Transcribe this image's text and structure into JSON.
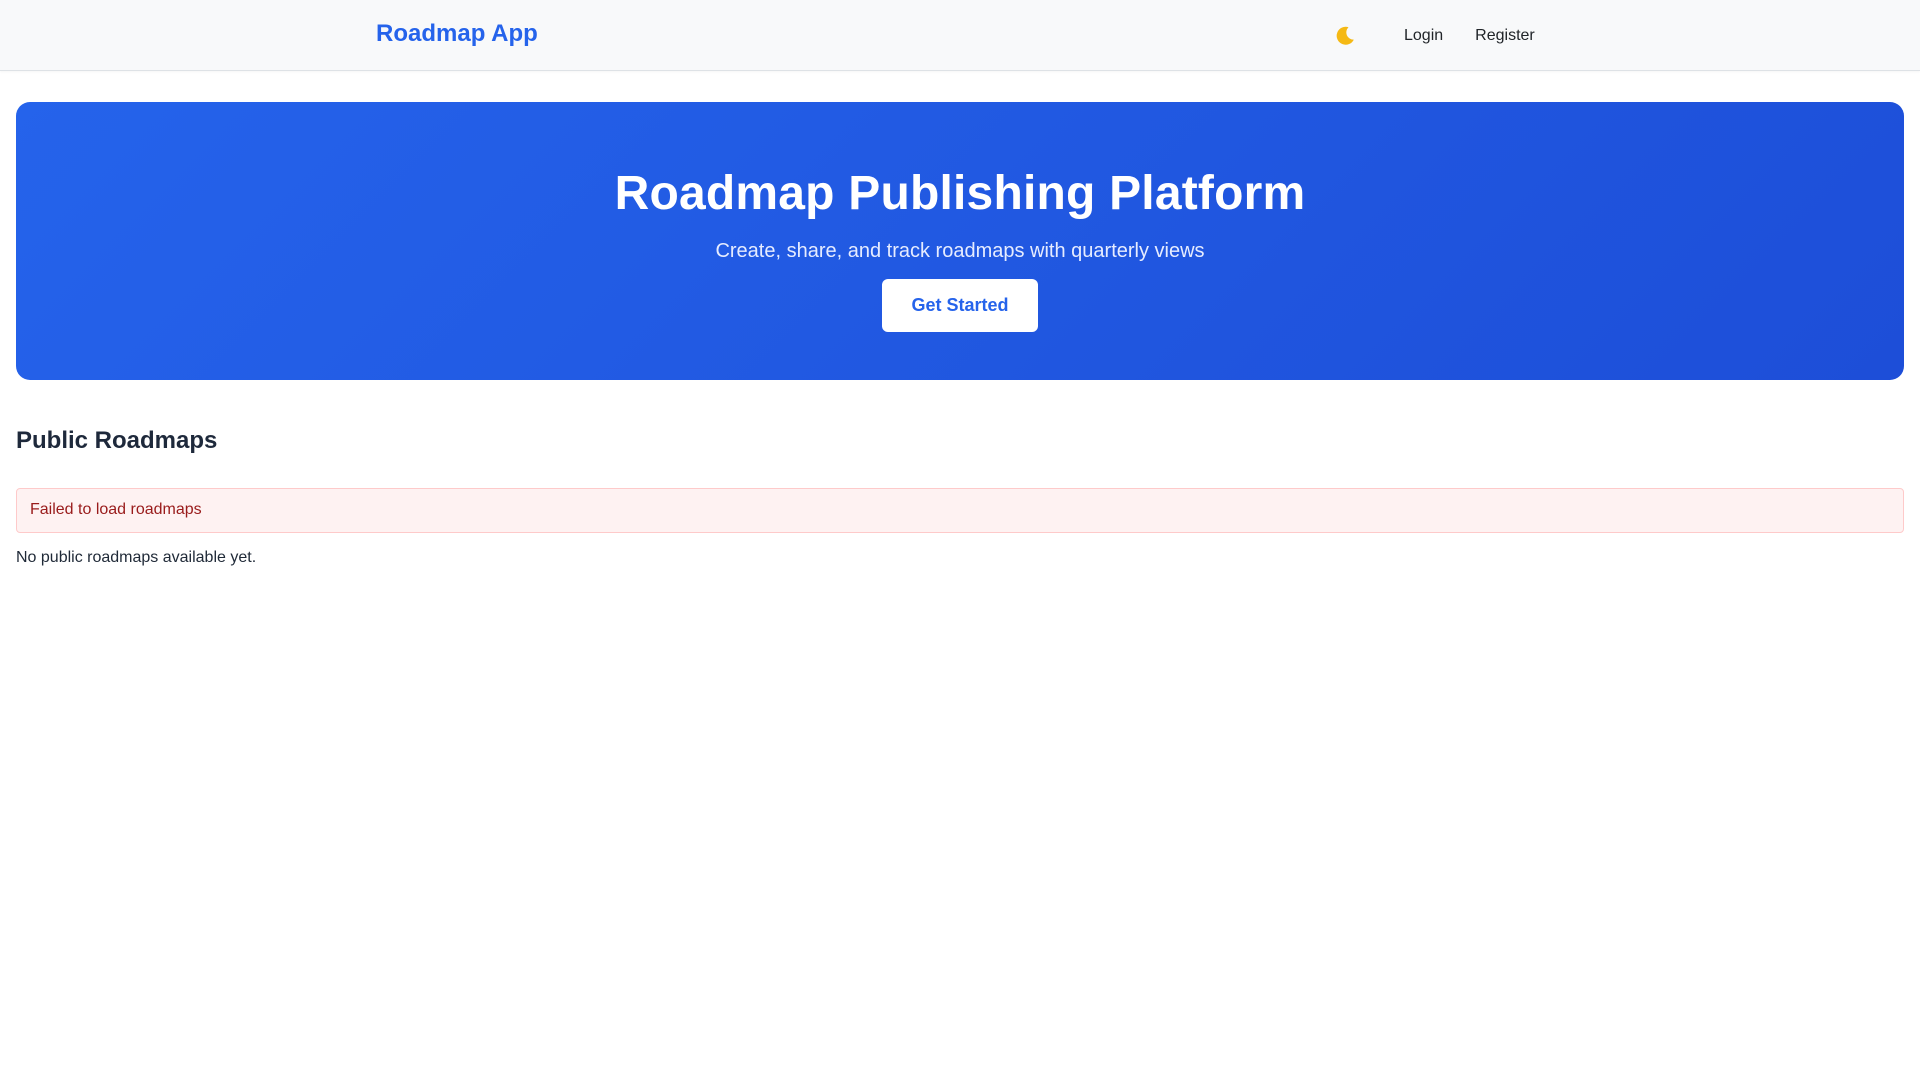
{
  "navbar": {
    "brand": "Roadmap App",
    "theme_toggle_icon": "moon-icon",
    "links": [
      {
        "label": "Login"
      },
      {
        "label": "Register"
      }
    ]
  },
  "hero": {
    "title": "Roadmap Publishing Platform",
    "subtitle": "Create, share, and track roadmaps with quarterly views",
    "cta_label": "Get Started"
  },
  "section": {
    "title": "Public Roadmaps",
    "error_message": "Failed to load roadmaps",
    "empty_message": "No public roadmaps available yet."
  },
  "colors": {
    "brand": "#2563eb",
    "hero_gradient_start": "#2563eb",
    "hero_gradient_end": "#1d4ed8",
    "error_bg": "#fef2f2",
    "error_border": "#fecaca",
    "error_text": "#991b1b",
    "moon": "#f5b914"
  }
}
